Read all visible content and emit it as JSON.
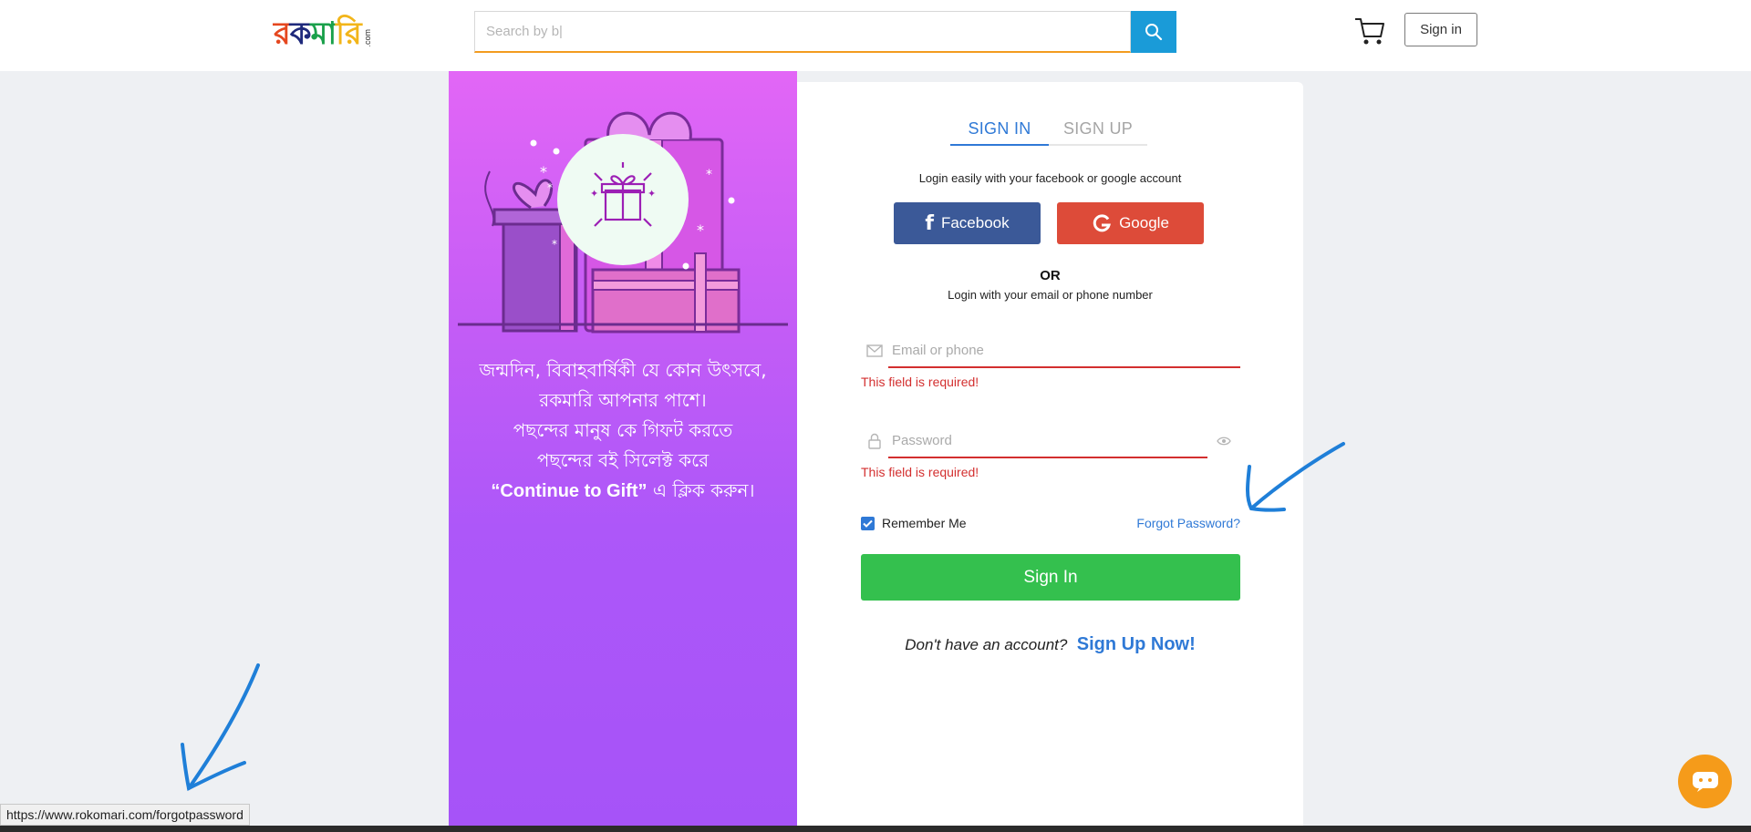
{
  "header": {
    "logo": {
      "text": "রকমারি",
      "suffix": ".com"
    },
    "search": {
      "placeholder": "Search by b|"
    },
    "signin_label": "Sign in",
    "icons": {
      "search": "search-icon",
      "cart": "cart-icon"
    }
  },
  "promo": {
    "lines": [
      "জন্মদিন, বিবাহবার্ষিকী যে কোন উৎসবে,",
      "রকমারি আপনার পাশে।",
      "পছন্দের মানুষ কে গিফট করতে",
      "পছন্দের বই সিলেক্ট করে"
    ],
    "last_line_bold": "“Continue to Gift”",
    "last_line_rest": " এ ক্লিক করুন।",
    "colors": {
      "top": "#e266f6",
      "bottom": "#a653f8"
    }
  },
  "login": {
    "tabs": [
      {
        "label": "SIGN IN",
        "active": true
      },
      {
        "label": "SIGN UP",
        "active": false
      }
    ],
    "social_caption": "Login easily with your facebook or google account",
    "facebook_label": "Facebook",
    "google_label": "Google",
    "or_label": "OR",
    "email_caption": "Login with your email or phone number",
    "email_placeholder": "Email or phone",
    "password_placeholder": "Password",
    "error_text": "This field is required!",
    "remember_label": "Remember Me",
    "remember_checked": true,
    "forgot_label": "Forgot Password?",
    "signin_button": "Sign In",
    "no_account": "Don't have an account?",
    "signup_link": "Sign Up Now!",
    "colors": {
      "accent": "#2f79d6",
      "error": "#d32f2f",
      "signin": "#34c04e",
      "facebook": "#3b5998",
      "google": "#dd4b39"
    }
  },
  "status_bar": {
    "url": "https://www.rokomari.com/forgotpassword"
  },
  "chat": {
    "icon": "chat-icon",
    "color": "#f59b1a"
  }
}
